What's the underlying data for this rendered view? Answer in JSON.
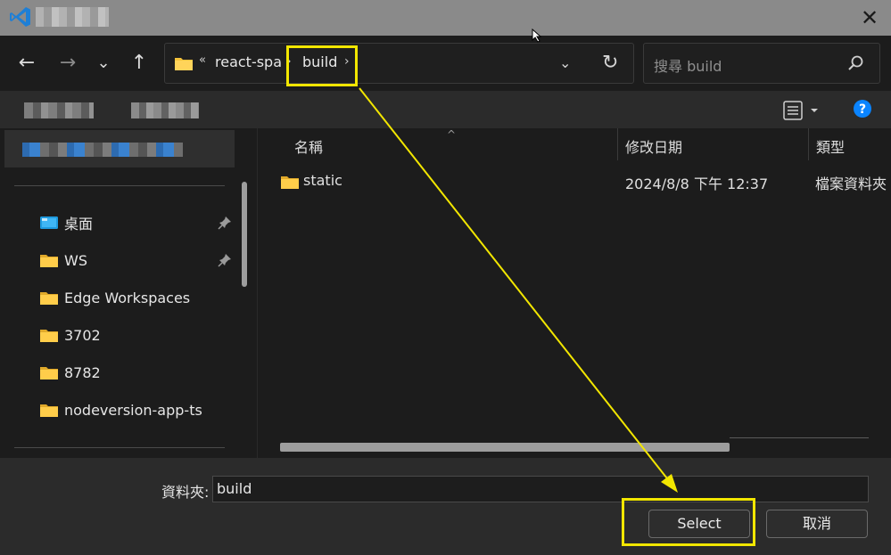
{
  "dialog": {
    "close_glyph": "✕"
  },
  "toolbar": {
    "back_glyph": "←",
    "forward_glyph": "→",
    "recent_glyph": "⌄",
    "up_glyph": "↑",
    "address": {
      "overflow_glyph": "«",
      "path": [
        "react-spa",
        "build"
      ],
      "separator_glyph": "›",
      "dropdown_glyph": "⌄",
      "refresh_glyph": "↻"
    },
    "search_placeholder": "搜尋 build"
  },
  "cmdbar": {
    "view_icon": "details-view-icon",
    "help_label": "?"
  },
  "sidebar": {
    "items": [
      {
        "label": "桌面",
        "icon": "desktop-icon",
        "pinned": true
      },
      {
        "label": "WS",
        "icon": "folder-icon",
        "pinned": true
      },
      {
        "label": "Edge Workspaces",
        "icon": "folder-icon",
        "pinned": false
      },
      {
        "label": "3702",
        "icon": "folder-icon",
        "pinned": false
      },
      {
        "label": "8782",
        "icon": "folder-icon",
        "pinned": false
      },
      {
        "label": "nodeversion-app-ts",
        "icon": "folder-icon",
        "pinned": false
      }
    ]
  },
  "file_list": {
    "columns": [
      "名稱",
      "修改日期",
      "類型"
    ],
    "sort_glyph": "^",
    "rows": [
      {
        "name": "static",
        "modified": "2024/8/8 下午 12:37",
        "type": "檔案資料夾"
      }
    ]
  },
  "footer": {
    "folder_label": "資料夾:",
    "folder_value": "build",
    "select_label": "Select",
    "cancel_label": "取消"
  },
  "colors": {
    "annotation": "#f2e600",
    "folder": "#f5c33b",
    "accent": "#0a84ff"
  }
}
